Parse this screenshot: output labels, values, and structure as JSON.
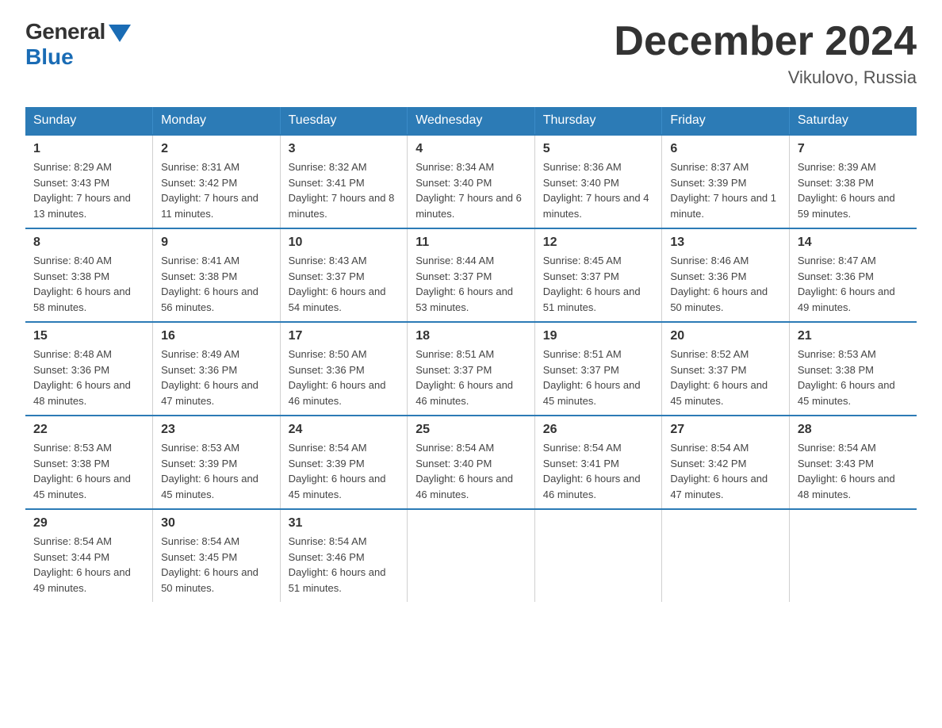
{
  "logo": {
    "general": "General",
    "blue": "Blue"
  },
  "title": "December 2024",
  "location": "Vikulovo, Russia",
  "days_of_week": [
    "Sunday",
    "Monday",
    "Tuesday",
    "Wednesday",
    "Thursday",
    "Friday",
    "Saturday"
  ],
  "weeks": [
    [
      {
        "day": "1",
        "sunrise": "8:29 AM",
        "sunset": "3:43 PM",
        "daylight": "7 hours and 13 minutes."
      },
      {
        "day": "2",
        "sunrise": "8:31 AM",
        "sunset": "3:42 PM",
        "daylight": "7 hours and 11 minutes."
      },
      {
        "day": "3",
        "sunrise": "8:32 AM",
        "sunset": "3:41 PM",
        "daylight": "7 hours and 8 minutes."
      },
      {
        "day": "4",
        "sunrise": "8:34 AM",
        "sunset": "3:40 PM",
        "daylight": "7 hours and 6 minutes."
      },
      {
        "day": "5",
        "sunrise": "8:36 AM",
        "sunset": "3:40 PM",
        "daylight": "7 hours and 4 minutes."
      },
      {
        "day": "6",
        "sunrise": "8:37 AM",
        "sunset": "3:39 PM",
        "daylight": "7 hours and 1 minute."
      },
      {
        "day": "7",
        "sunrise": "8:39 AM",
        "sunset": "3:38 PM",
        "daylight": "6 hours and 59 minutes."
      }
    ],
    [
      {
        "day": "8",
        "sunrise": "8:40 AM",
        "sunset": "3:38 PM",
        "daylight": "6 hours and 58 minutes."
      },
      {
        "day": "9",
        "sunrise": "8:41 AM",
        "sunset": "3:38 PM",
        "daylight": "6 hours and 56 minutes."
      },
      {
        "day": "10",
        "sunrise": "8:43 AM",
        "sunset": "3:37 PM",
        "daylight": "6 hours and 54 minutes."
      },
      {
        "day": "11",
        "sunrise": "8:44 AM",
        "sunset": "3:37 PM",
        "daylight": "6 hours and 53 minutes."
      },
      {
        "day": "12",
        "sunrise": "8:45 AM",
        "sunset": "3:37 PM",
        "daylight": "6 hours and 51 minutes."
      },
      {
        "day": "13",
        "sunrise": "8:46 AM",
        "sunset": "3:36 PM",
        "daylight": "6 hours and 50 minutes."
      },
      {
        "day": "14",
        "sunrise": "8:47 AM",
        "sunset": "3:36 PM",
        "daylight": "6 hours and 49 minutes."
      }
    ],
    [
      {
        "day": "15",
        "sunrise": "8:48 AM",
        "sunset": "3:36 PM",
        "daylight": "6 hours and 48 minutes."
      },
      {
        "day": "16",
        "sunrise": "8:49 AM",
        "sunset": "3:36 PM",
        "daylight": "6 hours and 47 minutes."
      },
      {
        "day": "17",
        "sunrise": "8:50 AM",
        "sunset": "3:36 PM",
        "daylight": "6 hours and 46 minutes."
      },
      {
        "day": "18",
        "sunrise": "8:51 AM",
        "sunset": "3:37 PM",
        "daylight": "6 hours and 46 minutes."
      },
      {
        "day": "19",
        "sunrise": "8:51 AM",
        "sunset": "3:37 PM",
        "daylight": "6 hours and 45 minutes."
      },
      {
        "day": "20",
        "sunrise": "8:52 AM",
        "sunset": "3:37 PM",
        "daylight": "6 hours and 45 minutes."
      },
      {
        "day": "21",
        "sunrise": "8:53 AM",
        "sunset": "3:38 PM",
        "daylight": "6 hours and 45 minutes."
      }
    ],
    [
      {
        "day": "22",
        "sunrise": "8:53 AM",
        "sunset": "3:38 PM",
        "daylight": "6 hours and 45 minutes."
      },
      {
        "day": "23",
        "sunrise": "8:53 AM",
        "sunset": "3:39 PM",
        "daylight": "6 hours and 45 minutes."
      },
      {
        "day": "24",
        "sunrise": "8:54 AM",
        "sunset": "3:39 PM",
        "daylight": "6 hours and 45 minutes."
      },
      {
        "day": "25",
        "sunrise": "8:54 AM",
        "sunset": "3:40 PM",
        "daylight": "6 hours and 46 minutes."
      },
      {
        "day": "26",
        "sunrise": "8:54 AM",
        "sunset": "3:41 PM",
        "daylight": "6 hours and 46 minutes."
      },
      {
        "day": "27",
        "sunrise": "8:54 AM",
        "sunset": "3:42 PM",
        "daylight": "6 hours and 47 minutes."
      },
      {
        "day": "28",
        "sunrise": "8:54 AM",
        "sunset": "3:43 PM",
        "daylight": "6 hours and 48 minutes."
      }
    ],
    [
      {
        "day": "29",
        "sunrise": "8:54 AM",
        "sunset": "3:44 PM",
        "daylight": "6 hours and 49 minutes."
      },
      {
        "day": "30",
        "sunrise": "8:54 AM",
        "sunset": "3:45 PM",
        "daylight": "6 hours and 50 minutes."
      },
      {
        "day": "31",
        "sunrise": "8:54 AM",
        "sunset": "3:46 PM",
        "daylight": "6 hours and 51 minutes."
      },
      null,
      null,
      null,
      null
    ]
  ]
}
